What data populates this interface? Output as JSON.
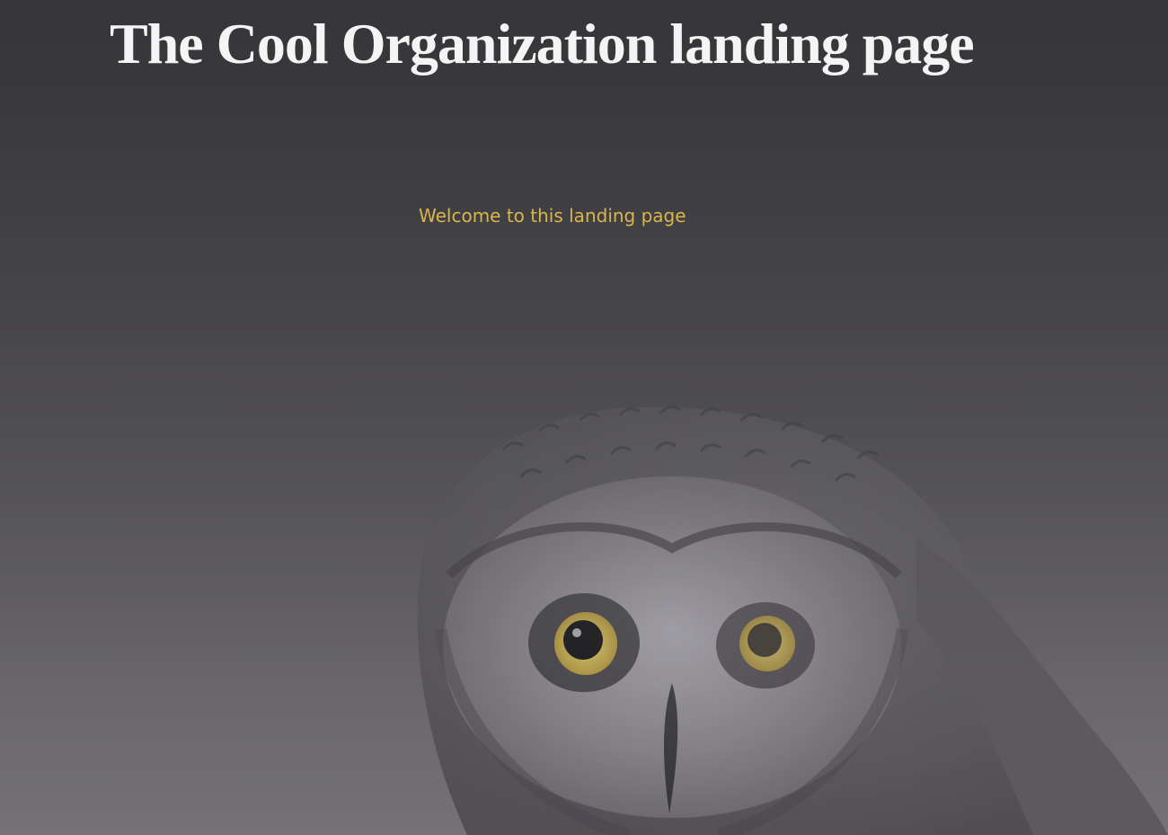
{
  "header": {
    "title": "The Cool Organization landing page"
  },
  "main": {
    "welcome_text": "Welcome to this landing page"
  },
  "background": {
    "image_subject": "owl-photo",
    "overlay": "dark-gradient"
  },
  "colors": {
    "title": "#f4f4f4",
    "welcome_text": "#d9b54b",
    "background_top": "#1c1c1f",
    "background_bottom": "#747275",
    "owl_eye": "#d8c15a"
  }
}
